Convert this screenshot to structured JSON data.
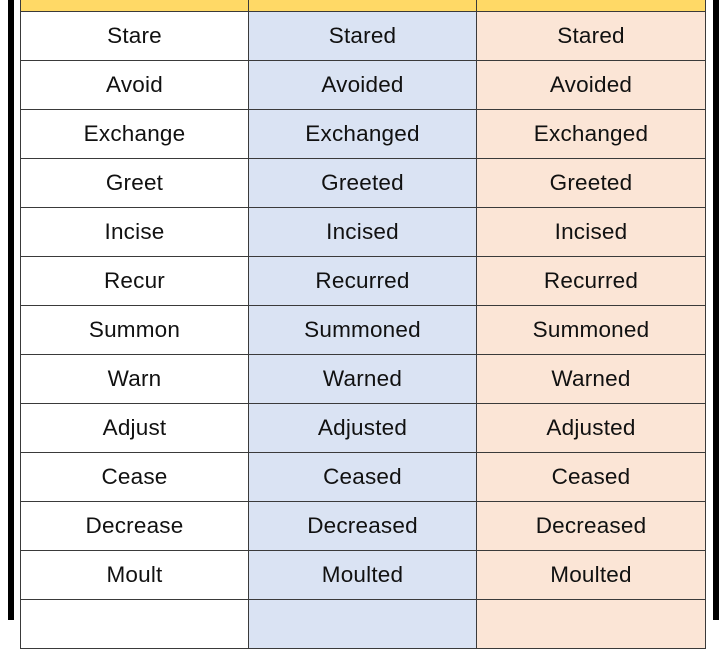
{
  "colors": {
    "header": "#ffd966",
    "base_column": "#ffffff",
    "past_column": "#dae3f3",
    "past_participle_column": "#fbe5d6",
    "frame": "#000000"
  },
  "table": {
    "header": [
      "",
      "",
      ""
    ],
    "rows": [
      {
        "base": "Stare",
        "past": "Stared",
        "past_participle": "Stared"
      },
      {
        "base": "Avoid",
        "past": "Avoided",
        "past_participle": "Avoided"
      },
      {
        "base": "Exchange",
        "past": "Exchanged",
        "past_participle": "Exchanged"
      },
      {
        "base": "Greet",
        "past": "Greeted",
        "past_participle": "Greeted"
      },
      {
        "base": "Incise",
        "past": "Incised",
        "past_participle": "Incised"
      },
      {
        "base": "Recur",
        "past": "Recurred",
        "past_participle": "Recurred"
      },
      {
        "base": "Summon",
        "past": "Summoned",
        "past_participle": "Summoned"
      },
      {
        "base": "Warn",
        "past": "Warned",
        "past_participle": "Warned"
      },
      {
        "base": "Adjust",
        "past": "Adjusted",
        "past_participle": "Adjusted"
      },
      {
        "base": "Cease",
        "past": "Ceased",
        "past_participle": "Ceased"
      },
      {
        "base": "Decrease",
        "past": "Decreased",
        "past_participle": "Decreased"
      },
      {
        "base": "Moult",
        "past": "Moulted",
        "past_participle": "Moulted"
      },
      {
        "base": "",
        "past": "",
        "past_participle": ""
      }
    ]
  }
}
